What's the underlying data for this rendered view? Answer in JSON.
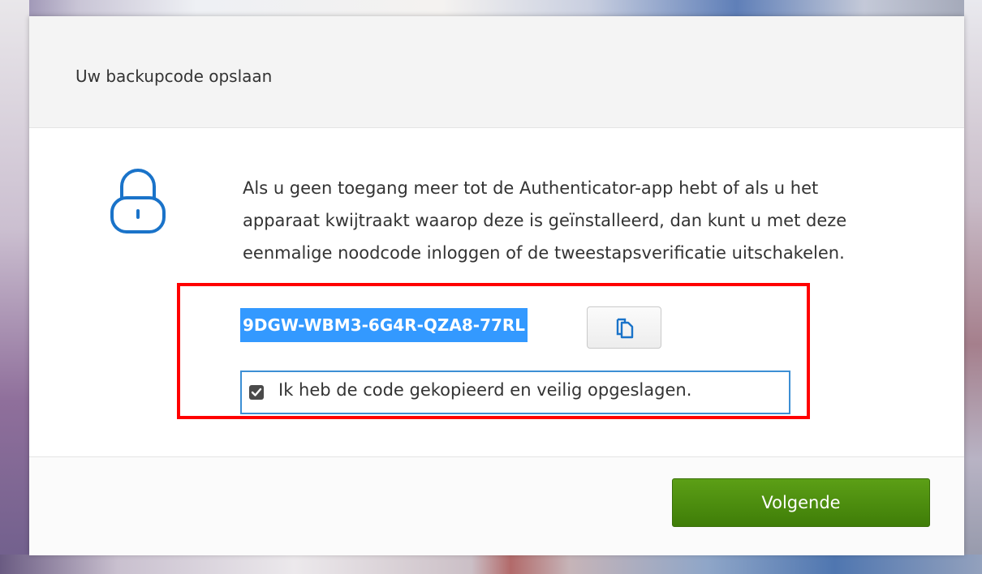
{
  "dialog": {
    "title": "Uw backupcode opslaan",
    "icon": "lock-icon",
    "message": "Als u geen toegang meer tot de Authenticator-app hebt of als u het apparaat kwijtraakt waarop deze is geïnstalleerd, dan kunt u met deze eenmalige noodcode inloggen of de tweestapsverificatie uitschakelen.",
    "backup_code": "9DGW-WBM3-6G4R-QZA8-77RL",
    "copy_button_icon": "copy-icon",
    "confirm_checkbox": {
      "label": "Ik heb de code gekopieerd en veilig opgeslagen.",
      "checked": true
    },
    "next_button_label": "Volgende"
  },
  "colors": {
    "accent_blue": "#3399ff",
    "next_button_green": "#4a8a0f",
    "highlight_red": "#ff0000",
    "focus_outline": "#3c8fd4"
  }
}
